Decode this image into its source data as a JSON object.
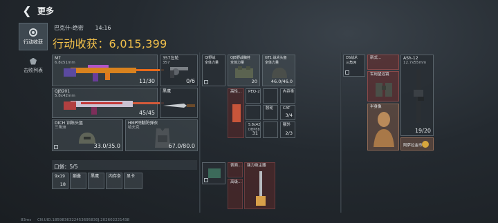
{
  "header": {
    "back_icon": "back-arrow-icon",
    "title": "更多"
  },
  "sidebar": [
    {
      "label": "行动收获",
      "icon": "target-icon",
      "active": true
    },
    {
      "label": "击败列表",
      "icon": "badge-icon",
      "active": false
    }
  ],
  "info": {
    "map": "巴克什-绝密",
    "time": "14:16",
    "earnings_label": "行动收获：",
    "earnings": "6,015,399"
  },
  "weapons": {
    "primary": {
      "name": "M7",
      "sub": "6.8x51mm",
      "ammo": "11/30"
    },
    "pistol": {
      "name": "357左轮",
      "sub": "357",
      "ammo": "0/6"
    },
    "secondary": {
      "name": "QJB201",
      "sub": "5.8x42mm",
      "ammo": "45/45"
    },
    "melee": {
      "name": "黑鹰"
    },
    "helmet": {
      "name": "DICH 训练头盔",
      "sub": "三角洲",
      "durability": "33.0/35.0"
    },
    "armor": {
      "name": "HMP特勤防弹衣",
      "sub": "哈夫克",
      "durability": "67.0/80.0"
    }
  },
  "pouch": {
    "label": "口袋：",
    "count": "5/5",
    "items": [
      {
        "name": "9x19",
        "count": "18"
      },
      {
        "name": "巅叠"
      },
      {
        "name": "黑鹰"
      },
      {
        "name": "内存条"
      },
      {
        "name": "显卡"
      }
    ]
  },
  "rig": {
    "items": [
      {
        "name": "QJ野战\n全体力量"
      },
      {
        "name": "QJB野战胸挂\n全体力量",
        "count": "20"
      },
      {
        "name": "GT1 战术头盔\n全体力量",
        "durability": "46.0/46.0"
      },
      {
        "name": "高性..."
      },
      {
        "name": "PEQ-2"
      },
      {
        "name": "内存条"
      },
      {
        "name": "胶轮"
      },
      {
        "name": "CAT",
        "count": "3/4"
      },
      {
        "name": "5.8x42",
        "sub": "DBP88",
        "count": "31"
      },
      {
        "name": "额外",
        "count": "2/3"
      }
    ]
  },
  "backpack": {
    "items": [
      {
        "name": "表面..."
      },
      {
        "name": "强力吸尘器"
      },
      {
        "name": "高级..."
      }
    ]
  },
  "case": {
    "items": [
      {
        "name": "DS战术\n三角洲"
      },
      {
        "name": "新式..."
      },
      {
        "name": "ASh-12",
        "sub": "12.7x55mm",
        "ammo": "19/20"
      },
      {
        "name": "军用望远镜"
      },
      {
        "name": "半身像"
      },
      {
        "name": "阿萨拉金币"
      }
    ]
  },
  "status": {
    "ping": "83ms",
    "uid": "CN.UID.1859836322453695830J.202602221438"
  }
}
